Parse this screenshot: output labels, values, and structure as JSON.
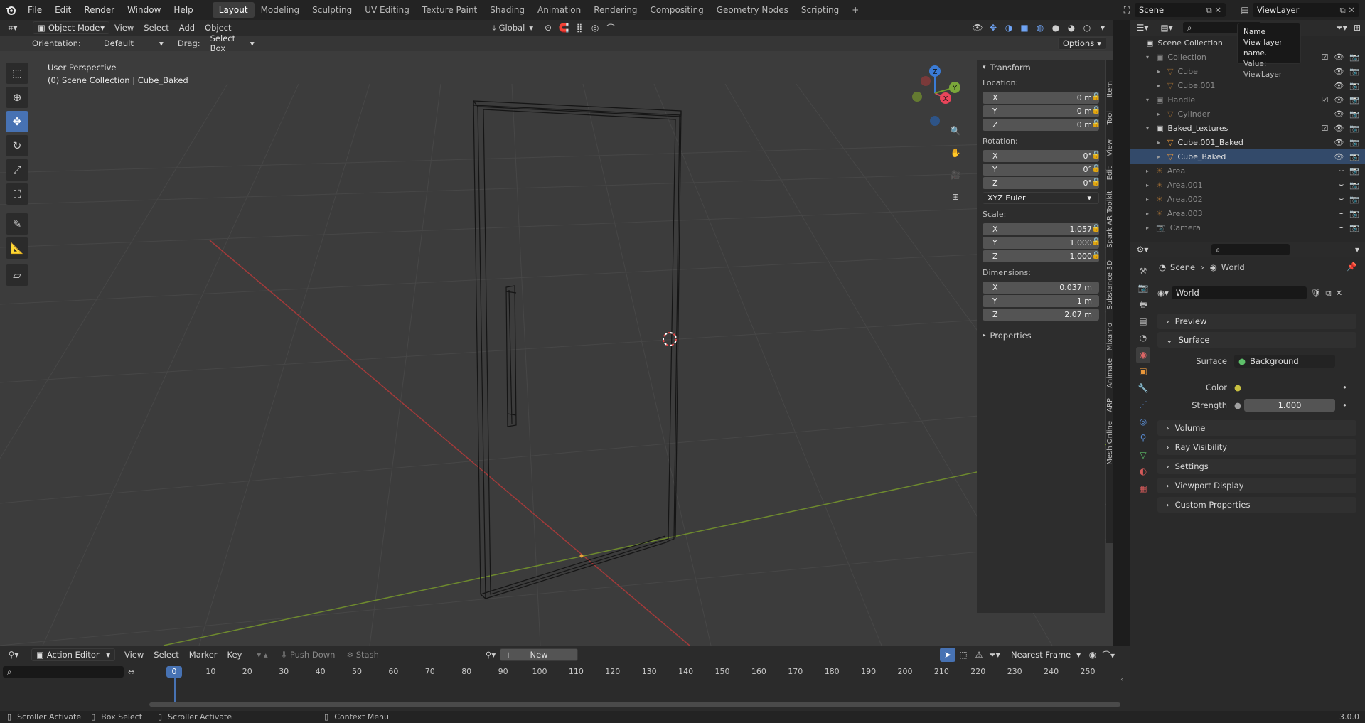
{
  "topbar": {
    "menus": [
      "File",
      "Edit",
      "Render",
      "Window",
      "Help"
    ],
    "workspaces": [
      "Layout",
      "Modeling",
      "Sculpting",
      "UV Editing",
      "Texture Paint",
      "Shading",
      "Animation",
      "Rendering",
      "Compositing",
      "Geometry Nodes",
      "Scripting"
    ],
    "active_workspace": "Layout",
    "add_tab": "+",
    "scene": "Scene",
    "view_layer": "ViewLayer"
  },
  "viewport": {
    "mode": "Object Mode",
    "menus": [
      "View",
      "Select",
      "Add",
      "Object"
    ],
    "transform_orientation": "Global",
    "orientation_label": "Orientation:",
    "orientation_value": "Default",
    "drag_label": "Drag:",
    "drag_value": "Select Box",
    "options": "Options",
    "overlay_line1": "User Perspective",
    "overlay_line2": "(0) Scene Collection | Cube_Baked",
    "gizmo": {
      "x": "X",
      "y": "Y",
      "z": "Z"
    }
  },
  "npanel": {
    "transform_title": "Transform",
    "location_label": "Location:",
    "location": [
      {
        "axis": "X",
        "value": "0 m"
      },
      {
        "axis": "Y",
        "value": "0 m"
      },
      {
        "axis": "Z",
        "value": "0 m"
      }
    ],
    "rotation_label": "Rotation:",
    "rotation": [
      {
        "axis": "X",
        "value": "0°"
      },
      {
        "axis": "Y",
        "value": "0°"
      },
      {
        "axis": "Z",
        "value": "0°"
      }
    ],
    "rotation_mode": "XYZ Euler",
    "scale_label": "Scale:",
    "scale": [
      {
        "axis": "X",
        "value": "1.057"
      },
      {
        "axis": "Y",
        "value": "1.000"
      },
      {
        "axis": "Z",
        "value": "1.000"
      }
    ],
    "dimensions_label": "Dimensions:",
    "dimensions": [
      {
        "axis": "X",
        "value": "0.037 m"
      },
      {
        "axis": "Y",
        "value": "1 m"
      },
      {
        "axis": "Z",
        "value": "2.07 m"
      }
    ],
    "properties_title": "Properties",
    "tabs": [
      "Item",
      "Tool",
      "View",
      "Edit",
      "Spark AR Toolkit",
      "Substance 3D",
      "Mixamo",
      "Animate",
      "ARP",
      "Mesh Online"
    ]
  },
  "outliner": {
    "root": "Scene Collection",
    "items": [
      {
        "name": "Collection",
        "indent": 1,
        "type": "collection",
        "dim": true
      },
      {
        "name": "Cube",
        "indent": 2,
        "type": "mesh",
        "dim": true
      },
      {
        "name": "Cube.001",
        "indent": 2,
        "type": "mesh",
        "dim": true
      },
      {
        "name": "Handle",
        "indent": 1,
        "type": "collection",
        "dim": true
      },
      {
        "name": "Cylinder",
        "indent": 2,
        "type": "mesh",
        "dim": true
      },
      {
        "name": "Baked_textures",
        "indent": 1,
        "type": "collection",
        "dim": false
      },
      {
        "name": "Cube.001_Baked",
        "indent": 2,
        "type": "mesh",
        "dim": false
      },
      {
        "name": "Cube_Baked",
        "indent": 2,
        "type": "mesh",
        "dim": false
      },
      {
        "name": "Area",
        "indent": 1,
        "type": "light",
        "dim": true
      },
      {
        "name": "Area.001",
        "indent": 1,
        "type": "light",
        "dim": true
      },
      {
        "name": "Area.002",
        "indent": 1,
        "type": "light",
        "dim": true
      },
      {
        "name": "Area.003",
        "indent": 1,
        "type": "light",
        "dim": true
      },
      {
        "name": "Camera",
        "indent": 1,
        "type": "camera",
        "dim": true
      }
    ],
    "tooltip": {
      "title": "Name",
      "desc": "View layer name.",
      "value": "Value: ViewLayer"
    }
  },
  "properties": {
    "breadcrumb_scene": "Scene",
    "breadcrumb_world": "World",
    "world_name": "World",
    "panels": [
      "Preview",
      "Surface",
      "Volume",
      "Ray Visibility",
      "Settings",
      "Viewport Display",
      "Custom Properties"
    ],
    "surface_label": "Surface",
    "surface_value": "Background",
    "color_label": "Color",
    "strength_label": "Strength",
    "strength_value": "1.000"
  },
  "timeline": {
    "editor": "Action Editor",
    "menus": [
      "View",
      "Select",
      "Marker",
      "Key"
    ],
    "push_down": "Push Down",
    "stash": "Stash",
    "new": "New",
    "snap": "Nearest Frame",
    "current_frame": "0",
    "frames": [
      "10",
      "20",
      "30",
      "40",
      "50",
      "60",
      "70",
      "80",
      "90",
      "100",
      "110",
      "120",
      "130",
      "140",
      "150",
      "160",
      "170",
      "180",
      "190",
      "200",
      "210",
      "220",
      "230",
      "240",
      "250"
    ]
  },
  "statusbar": {
    "hint1": "Scroller Activate",
    "hint2": "Box Select",
    "hint3": "Scroller Activate",
    "hint4": "Context Menu",
    "version": "3.0.0"
  },
  "colors": {
    "accent": "#4772b3",
    "x_axis": "#a33a3a",
    "y_axis": "#6e8a2e",
    "z_axis": "#3a7bd5"
  }
}
